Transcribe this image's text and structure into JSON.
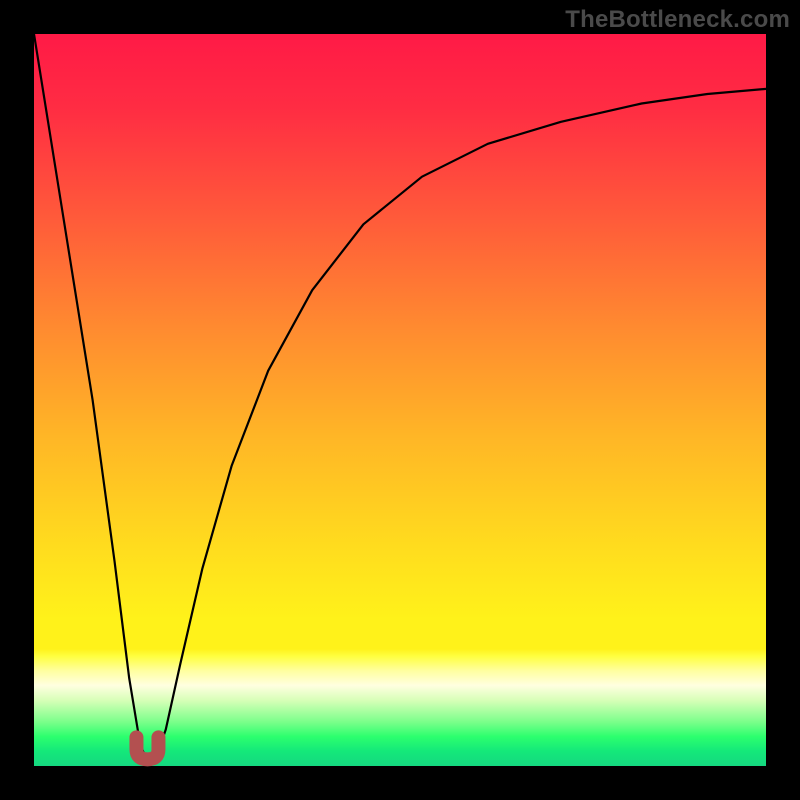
{
  "watermark": "TheBottleneck.com",
  "chart_data": {
    "type": "line",
    "title": "",
    "xlabel": "",
    "ylabel": "",
    "xlim": [
      0,
      100
    ],
    "ylim": [
      0,
      100
    ],
    "grid": false,
    "legend": false,
    "series": [
      {
        "name": "bottleneck-curve",
        "x": [
          0,
          4,
          8,
          11,
          13,
          14.5,
          15.5,
          16.8,
          18,
          20,
          23,
          27,
          32,
          38,
          45,
          53,
          62,
          72,
          83,
          92,
          100
        ],
        "y": [
          100,
          75,
          50,
          28,
          12,
          3,
          0.5,
          1.5,
          5,
          14,
          27,
          41,
          54,
          65,
          74,
          80.5,
          85,
          88,
          90.5,
          91.8,
          92.5
        ]
      }
    ],
    "annotations": [
      {
        "name": "optimal-marker",
        "shape": "u",
        "x": 15.5,
        "y": 2,
        "color": "#b35050"
      }
    ]
  }
}
